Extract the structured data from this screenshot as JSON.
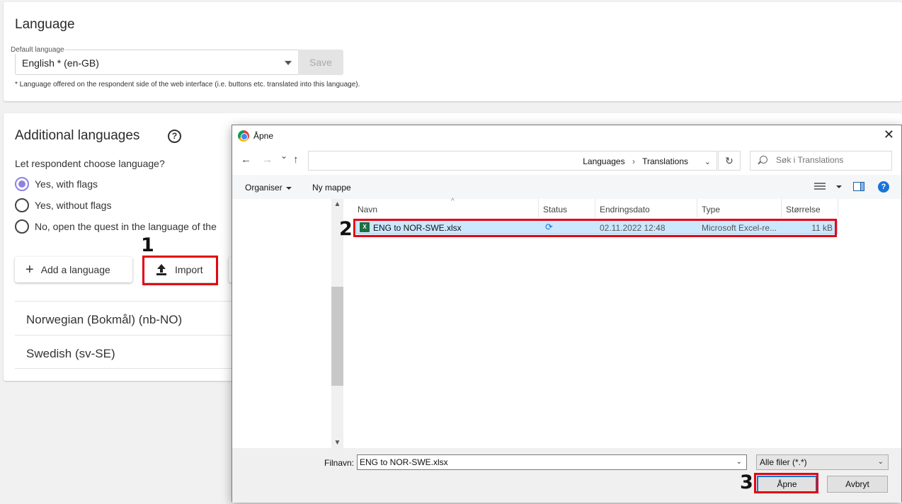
{
  "language_card": {
    "title": "Language",
    "default_label": "Default language",
    "default_value": "English * (en-GB)",
    "save_label": "Save",
    "note": "* Language offered on the respondent side of the web interface (i.e. buttons etc. translated into this language)."
  },
  "additional_card": {
    "title": "Additional languages",
    "help_glyph": "?",
    "question": "Let respondent choose language?",
    "options": [
      {
        "label": "Yes, with flags",
        "selected": true
      },
      {
        "label": "Yes, without flags",
        "selected": false
      },
      {
        "label": "No, open the quest in the language of the",
        "selected": false
      }
    ],
    "add_button": "Add a language",
    "import_button": "Import",
    "languages": [
      "Norwegian (Bokmål) (nb-NO)",
      "Swedish (sv-SE)"
    ]
  },
  "steps": [
    "1",
    "2",
    "3"
  ],
  "highlight_color": "#e30613",
  "dialog": {
    "title": "Åpne",
    "close_glyph": "✕",
    "nav": {
      "back": "←",
      "forward": "→",
      "recent": "⌄",
      "up": "↑",
      "refresh": "↻",
      "address_dropdown": "⌄"
    },
    "breadcrumbs": [
      "Languages",
      "Translations"
    ],
    "crumb_sep": "›",
    "search_placeholder": "Søk i Translations",
    "toolbar": {
      "organize": "Organiser",
      "new_folder": "Ny mappe",
      "help": "?"
    },
    "scroll": {
      "up": "▲",
      "down": "▼",
      "sort": "^"
    },
    "columns": [
      "Navn",
      "Status",
      "Endringsdato",
      "Type",
      "Størrelse"
    ],
    "files": [
      {
        "icon": "X",
        "name": "ENG to NOR-SWE.xlsx",
        "status_icon": "⟳",
        "date": "02.11.2022 12:48",
        "type": "Microsoft Excel-re...",
        "size": "11 kB"
      }
    ],
    "filename_label": "Filnavn:",
    "filename_value": "ENG to NOR-SWE.xlsx",
    "filter": "Alle filer (*.*)",
    "dropdown_glyph": "⌄",
    "open_button": "Åpne",
    "cancel_button": "Avbryt"
  }
}
